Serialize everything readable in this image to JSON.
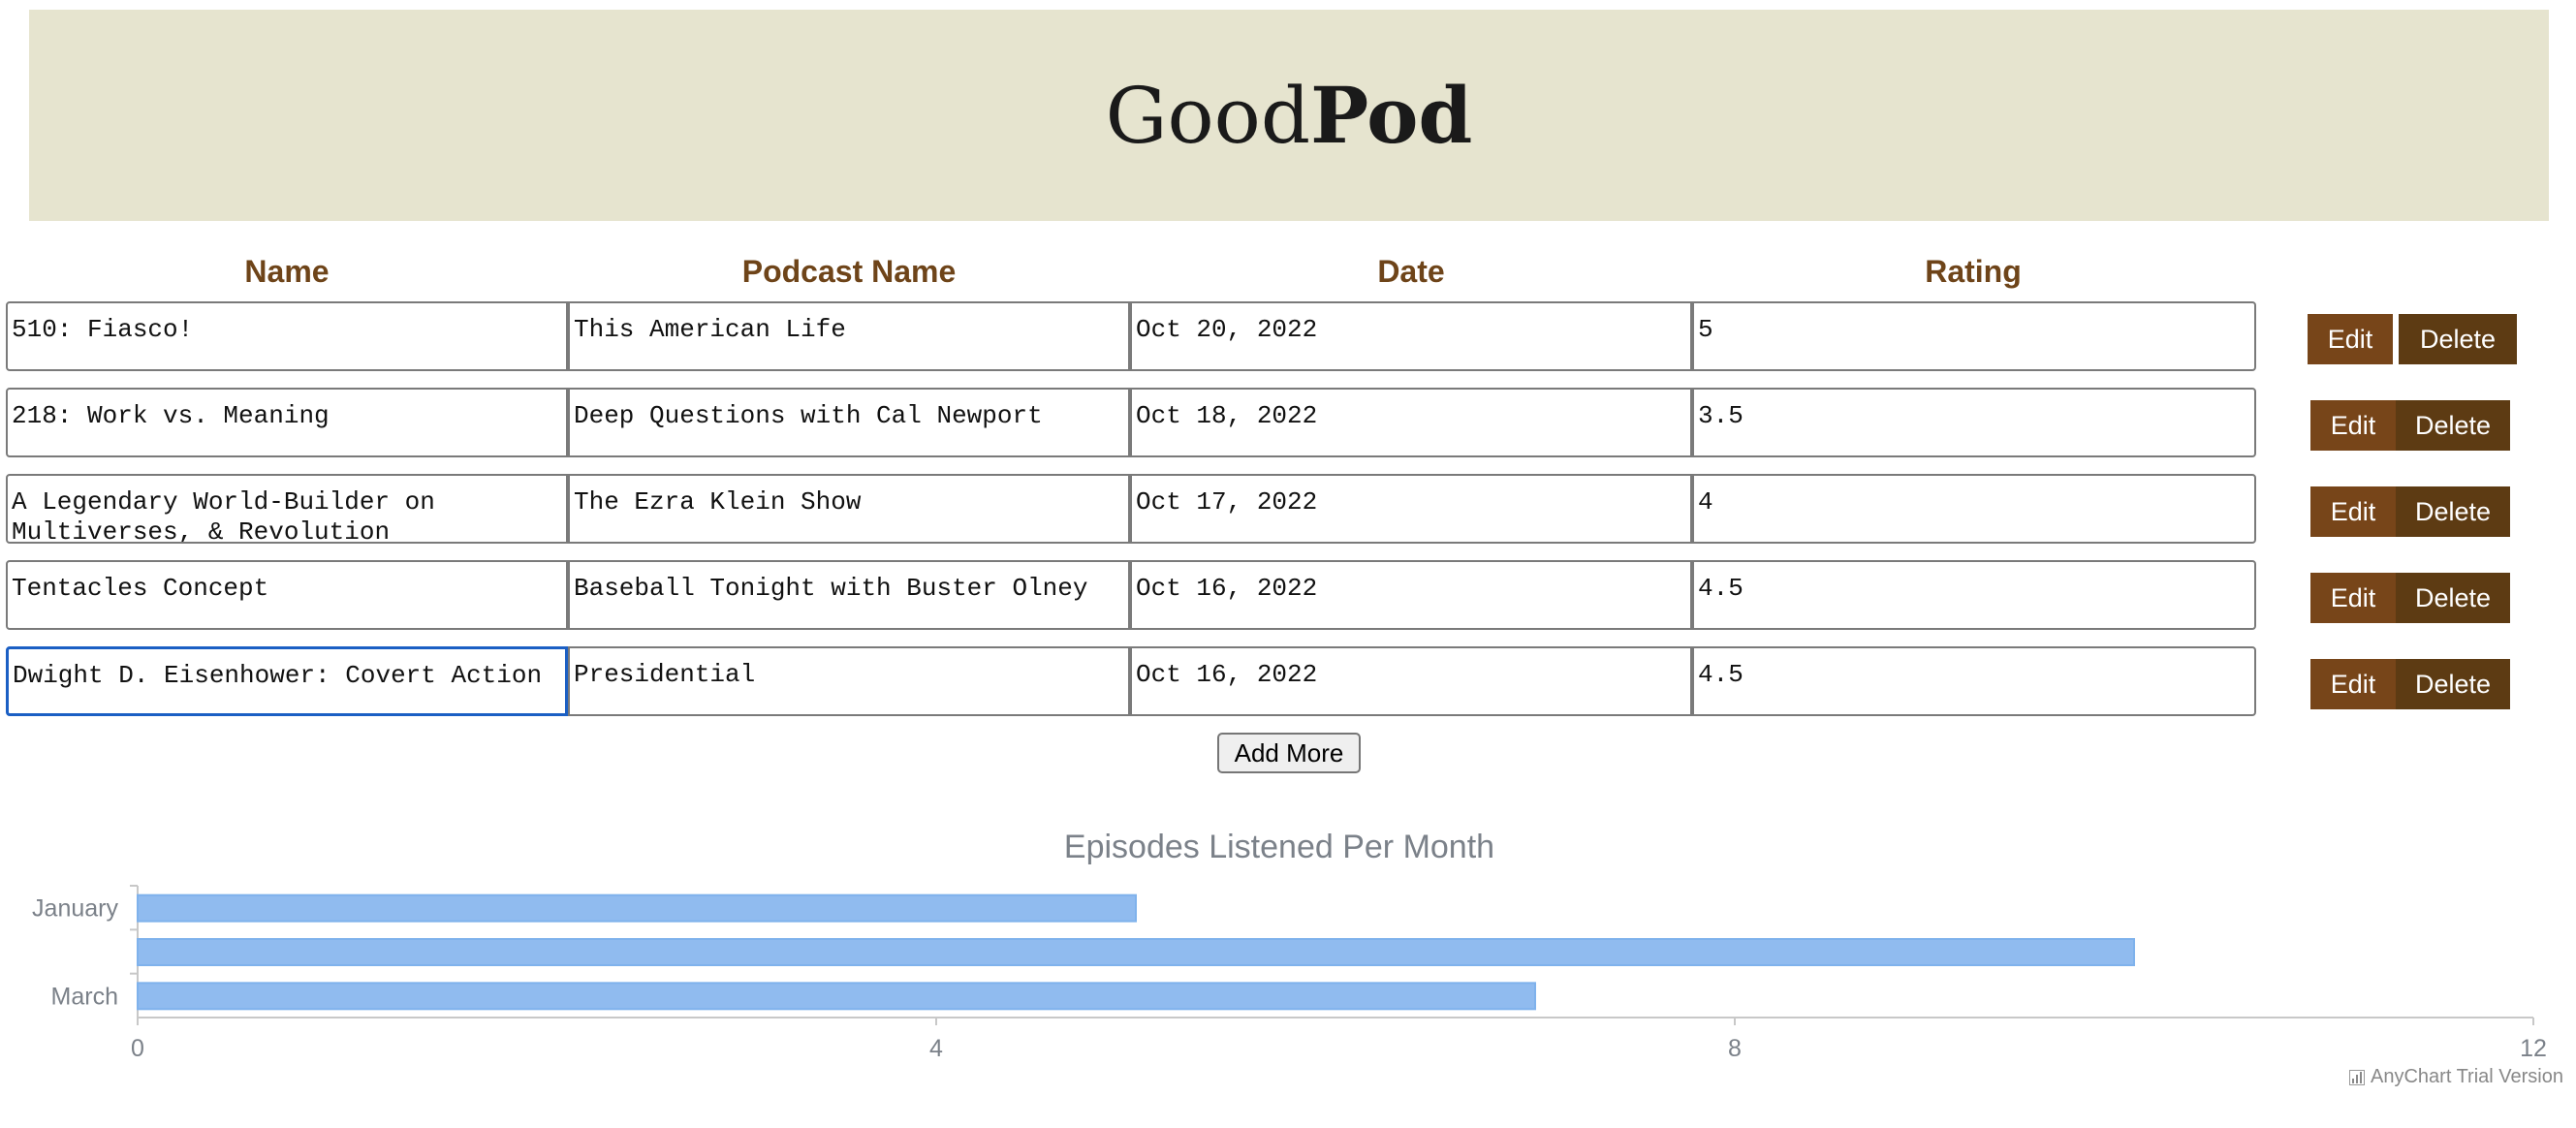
{
  "header": {
    "title_regular": "Good",
    "title_bold": "Pod"
  },
  "table": {
    "columns": [
      "Name",
      "Podcast Name",
      "Date",
      "Rating"
    ],
    "rows": [
      {
        "name": "510: Fiasco!",
        "podcast": "This American Life",
        "date": "Oct 20, 2022",
        "rating": "5"
      },
      {
        "name": "218: Work vs. Meaning",
        "podcast": "Deep Questions with Cal Newport",
        "date": "Oct 18, 2022",
        "rating": "3.5"
      },
      {
        "name": "A Legendary World-Builder on Multiverses, & Revolution",
        "podcast": "The Ezra Klein Show",
        "date": "Oct 17, 2022",
        "rating": "4"
      },
      {
        "name": "Tentacles Concept",
        "podcast": "Baseball Tonight with Buster Olney",
        "date": "Oct 16, 2022",
        "rating": "4.5"
      },
      {
        "name": "Dwight D. Eisenhower: Covert Action",
        "podcast": "Presidential",
        "date": "Oct 16, 2022",
        "rating": "4.5"
      }
    ],
    "edit_label": "Edit",
    "delete_label": "Delete",
    "add_more_label": "Add More"
  },
  "colors": {
    "header_bg": "#e6e4cf",
    "accent_brown": "#774519",
    "dark_brown": "#5d3b13",
    "bar_fill": "#90bbef",
    "focus_blue": "#1b5fc4"
  },
  "chart_data": {
    "type": "bar",
    "orientation": "horizontal",
    "title": "Episodes Listened Per Month",
    "categories": [
      "January",
      "",
      "March"
    ],
    "values": [
      5,
      10,
      7
    ],
    "xlim": [
      0,
      12
    ],
    "xticks": [
      0,
      4,
      8,
      12
    ],
    "grid": false
  },
  "watermark": "AnyChart Trial Version"
}
